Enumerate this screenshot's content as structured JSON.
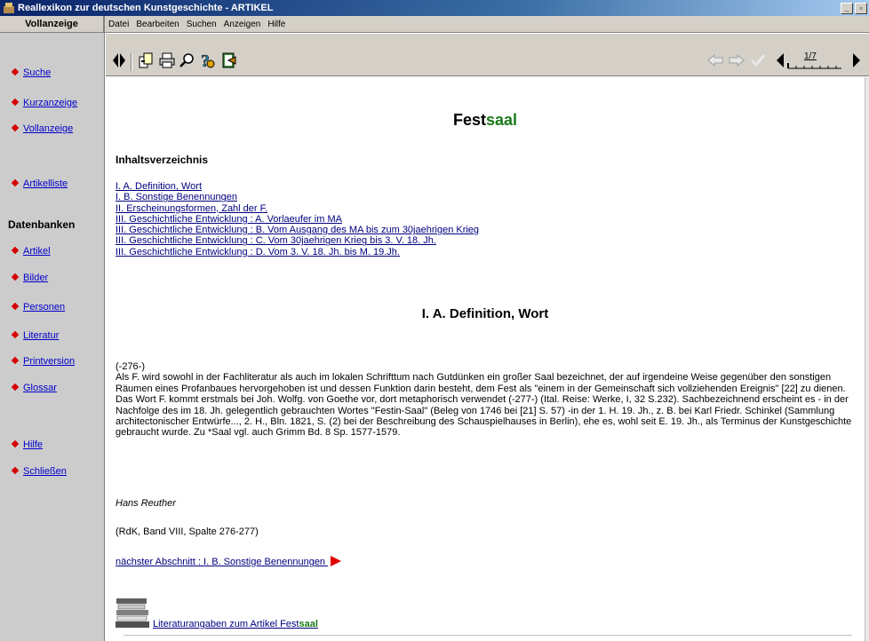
{
  "window": {
    "title": "Reallexikon zur deutschen Kunstgeschichte  -  ARTIKEL",
    "min_label": "_",
    "restore_label": "▫"
  },
  "left_panel": {
    "header": "Vollanzeige",
    "items_top": [
      {
        "label": "Suche"
      },
      {
        "label": "Kurzanzeige"
      },
      {
        "label": "Vollanzeige"
      },
      {
        "label": "Artikelliste"
      }
    ],
    "databases_heading": "Datenbanken",
    "items_db": [
      {
        "label": "Artikel"
      },
      {
        "label": "Bilder"
      },
      {
        "label": "Personen"
      },
      {
        "label": "Literatur"
      },
      {
        "label": "Printversion"
      },
      {
        "label": "Glossar"
      }
    ],
    "items_bottom": [
      {
        "label": "Hilfe"
      },
      {
        "label": "Schließen"
      }
    ]
  },
  "menu": {
    "items": [
      "Datei",
      "Bearbeiten",
      "Suchen",
      "Anzeigen",
      "Hilfe"
    ]
  },
  "toolbar": {
    "page_indicator": "1/7",
    "icons": [
      "split-arrows-icon",
      "copy-icon",
      "print-icon",
      "find-icon",
      "help-icon",
      "exit-icon",
      "back-icon",
      "forward-icon",
      "check-icon",
      "prev-page-icon",
      "next-page-icon"
    ]
  },
  "content": {
    "title_prefix": "Fest",
    "title_highlight": "saal",
    "toc_heading": "Inhaltsverzeichnis",
    "toc": [
      "I. A. Definition, Wort ",
      "I. B. Sonstige Benennungen ",
      "II. Erscheinungsformen, Zahl der F. ",
      "III. Geschichtliche Entwicklung : A. Vorlaeufer im MA ",
      "III. Geschichtliche Entwicklung : B. Vom Ausgang des MA bis zum 30jaehrigen Krieg ",
      "III. Geschichtliche Entwicklung : C. Vom 30jaehrigen Krieg bis 3. V. 18. Jh. ",
      "III. Geschichtliche Entwicklung : D. Vom 3. V. 18. Jh. bis M. 19.Jh. "
    ],
    "section_title": "I. A. Definition, Wort",
    "paragraphs": [
      "(-276-)",
      "Als F. wird sowohl in der Fachliteratur als auch im lokalen Schrifttum nach Gutdünken ein großer Saal bezeichnet, der auf irgendeine Weise gegenüber den sonstigen Räumen eines Profanbaues hervorgehoben ist und dessen Funktion darin besteht, dem Fest als \"einem in der Gemeinschaft sich vollziehenden Ereignis\" [22] zu dienen.",
      "Das Wort F. kommt erstmals bei Joh. Wolfg. von Goethe vor, dort metaphorisch verwendet (-277-) (Ital. Reise: Werke, I, 32 S.232). Sachbezeichnend erscheint es - in der Nachfolge des im 18. Jh. gelegentlich gebrauchten Wortes \"Festin-Saal\" (Beleg von 1746 bei [21] S. 57) -in der 1. H. 19. Jh., z. B. bei Karl Friedr. Schinkel (Sammlung architectonischer Entwürfe..., 2. H., Bln. 1821, S. (2) bei der Beschreibung des Schauspielhauses in Berlin), ehe es, wohl seit E. 19. Jh., als Terminus der Kunstgeschichte gebraucht wurde. Zu *Saal vgl. auch Grimm Bd. 8 Sp. 1577-1579."
    ],
    "author": "Hans Reuther",
    "source": "(RdK, Band VIII, Spalte 276-277)",
    "next_link": "nächster Abschnitt : I. B. Sonstige Benennungen ",
    "lit_link_prefix": " Literaturangaben zum Artikel Fest",
    "lit_link_highlight": "saal"
  }
}
